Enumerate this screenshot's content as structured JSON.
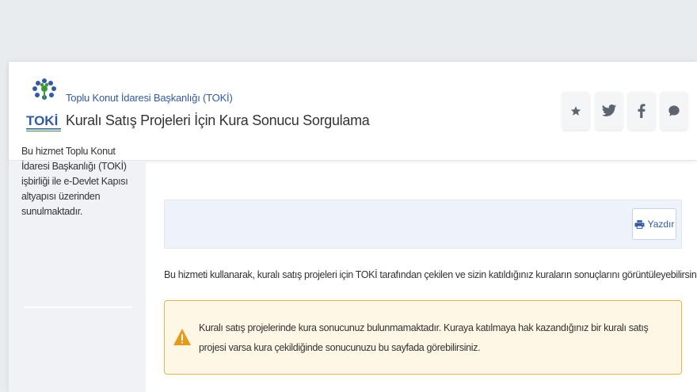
{
  "header": {
    "institution": "Toplu Konut İdaresi Başkanlığı (TOKİ)",
    "title": "Kuralı Satış Projeleri İçin Kura Sonucu Sorgulama",
    "logo_text": "TOKİ"
  },
  "social": [
    {
      "icon": "star-icon"
    },
    {
      "icon": "twitter-icon"
    },
    {
      "icon": "facebook-icon"
    },
    {
      "icon": "comment-icon"
    }
  ],
  "sidebar": {
    "description": "Bu hizmet Toplu Konut İdaresi Başkanlığı (TOKİ) işbirliği ile e-Devlet Kapısı altyapısı üzerinden sunulmaktadır."
  },
  "toolbar": {
    "print_label": "Yazdır"
  },
  "main": {
    "intro": "Bu hizmeti kullanarak, kuralı satış projeleri için TOKİ tarafından çekilen ve sizin katıldığınız kuraların sonuçlarını görüntüleyebilirsiniz.",
    "alert": "Kuralı satış projelerinde kura sonucunuz bulunmamaktadır. Kuraya katılmaya hak kazandığınız bir kuralı satış projesi varsa kura çekildiğinde sonucunuzu bu sayfada görebilirsiniz."
  },
  "colors": {
    "accent": "#2f5aa8",
    "logo_green": "#3a9a3a",
    "alert_border": "#f0b33d",
    "alert_bg": "#fff7e6",
    "warning_icon": "#e69a1a"
  }
}
